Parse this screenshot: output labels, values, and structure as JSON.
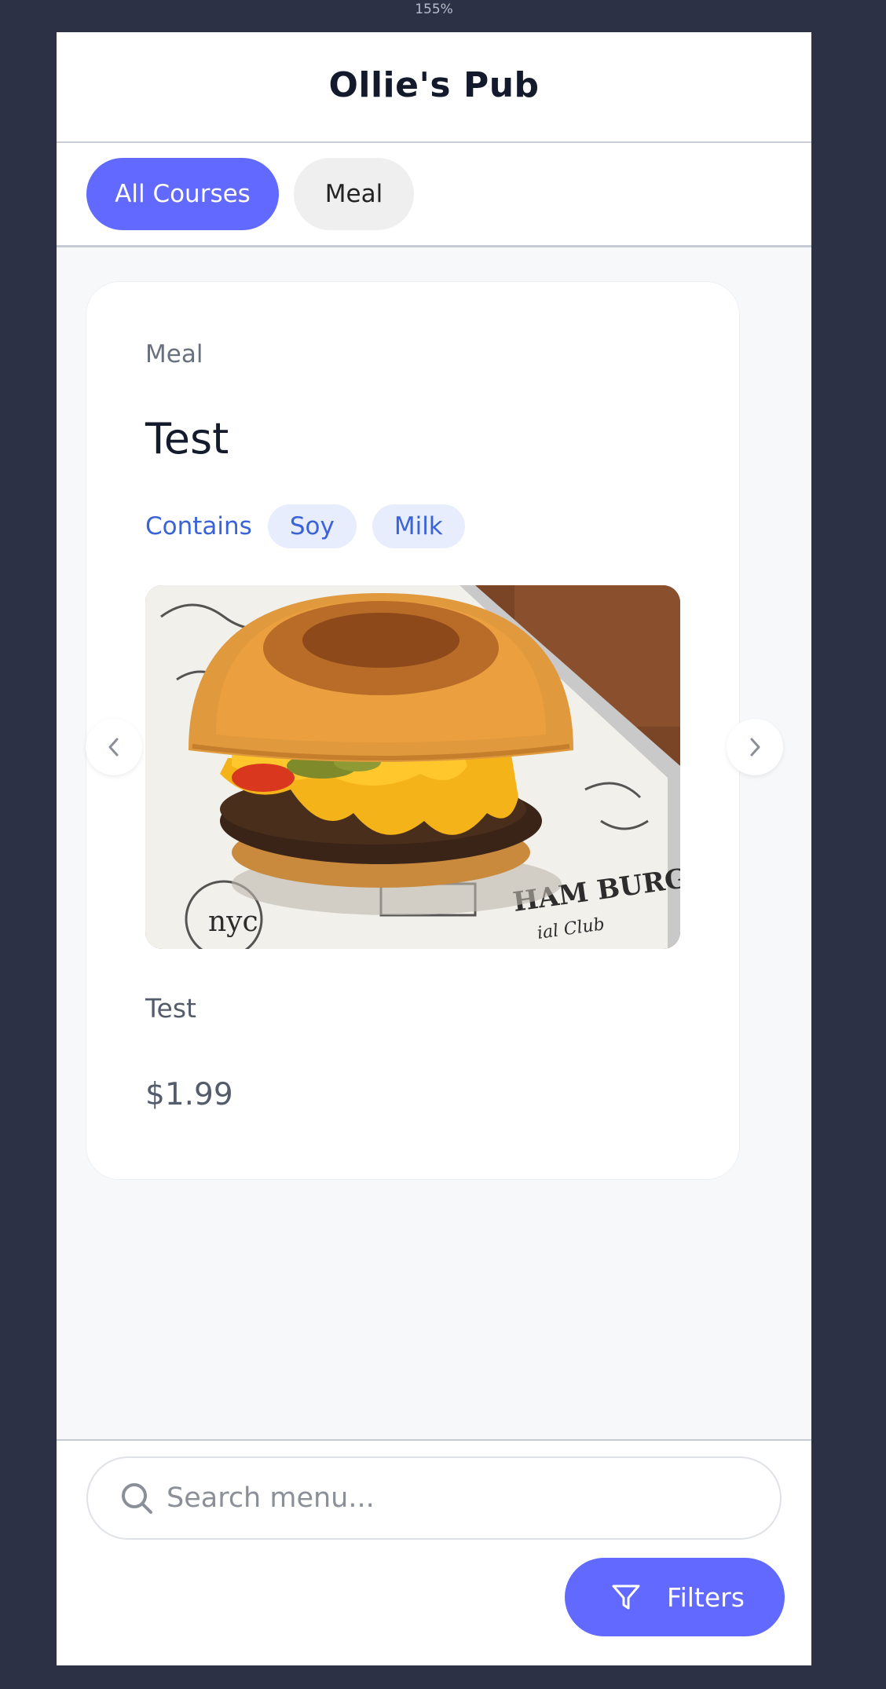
{
  "zoom": "155%",
  "header": {
    "title": "Ollie's Pub"
  },
  "tabs": [
    {
      "label": "All Courses",
      "active": true
    },
    {
      "label": "Meal",
      "active": false
    }
  ],
  "card": {
    "category": "Meal",
    "name": "Test",
    "contains_label": "Contains",
    "allergens": [
      "Soy",
      "Milk"
    ],
    "image": "cheeseburger-photo",
    "description": "Test",
    "price": "$1.99"
  },
  "search": {
    "placeholder": "Search menu..."
  },
  "filters": {
    "label": "Filters"
  },
  "colors": {
    "background": "#2d3145",
    "accent": "#6169ff",
    "allergen_text": "#3b63d8",
    "allergen_chip": "#e7edfd"
  }
}
